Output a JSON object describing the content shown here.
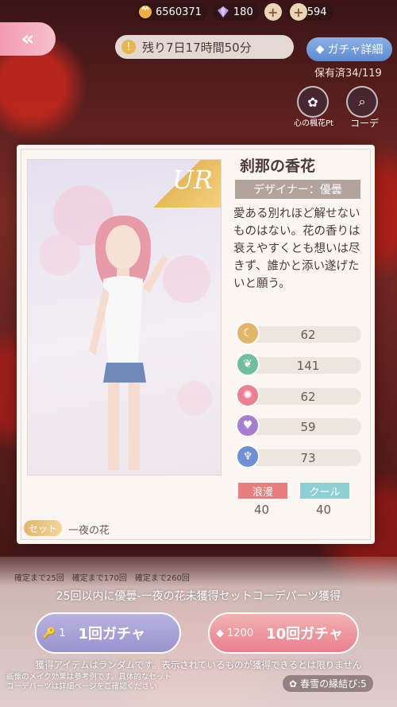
{
  "currency": {
    "coins": "6560371",
    "diamonds": "180",
    "pink_gems": "594"
  },
  "header": {
    "back_label": "«",
    "timer_prefix": "!",
    "timer": "残り7日17時間50分",
    "gacha_detail": "ガチャ詳細",
    "owned": "保有済34/119",
    "heart_pt_label": "心の楓花Pt",
    "coord_label": "コーデ"
  },
  "card": {
    "rarity": "UR",
    "title": "刹那の香花",
    "designer": "デザイナー：優曇",
    "description": "愛ある別れほど解せないものはない。花の香りは衰えやすくとも想いは尽きず、誰かと添い遂げたいと願う。",
    "stats": [
      {
        "icon": "moon-icon",
        "value": "62",
        "color": "#e2b66a"
      },
      {
        "icon": "leaf-icon",
        "value": "141",
        "color": "#6fbf9e"
      },
      {
        "icon": "sun-icon",
        "value": "62",
        "color": "#ec7f90"
      },
      {
        "icon": "heart-icon",
        "value": "59",
        "color": "#a67fd0"
      },
      {
        "icon": "wing-icon",
        "value": "73",
        "color": "#6f8fd6"
      }
    ],
    "tags": [
      {
        "label": "浪漫",
        "value": "40",
        "color": "#e97e7e"
      },
      {
        "label": "クール",
        "value": "40",
        "color": "#8ecfd6"
      }
    ],
    "set_label": "セット",
    "set_name": "一夜の花"
  },
  "progress": {
    "labels": [
      "確定まで25回",
      "確定まで170回",
      "確定まで260回"
    ]
  },
  "guarantee_text": "25回以内に優曇-一夜の花未獲得セットコーデパーツ獲得",
  "buttons": {
    "single_cost": "1",
    "single_label": "1回ガチャ",
    "ten_cost": "1200",
    "ten_label": "10回ガチャ"
  },
  "notes": {
    "line1": "獲得アイテムはランダムです。表示されているものが獲得できるとは限りません",
    "line2": "画像のメイク効果は参考例です。具体的なセット",
    "line3": "コーデパーツは詳細ページをご確認ください",
    "blossom": "春雪の縁結び:5"
  },
  "colors": {
    "accent_pink": "#e87f8f",
    "accent_blue": "#5f8ad0",
    "gold": "#e2b66a"
  }
}
